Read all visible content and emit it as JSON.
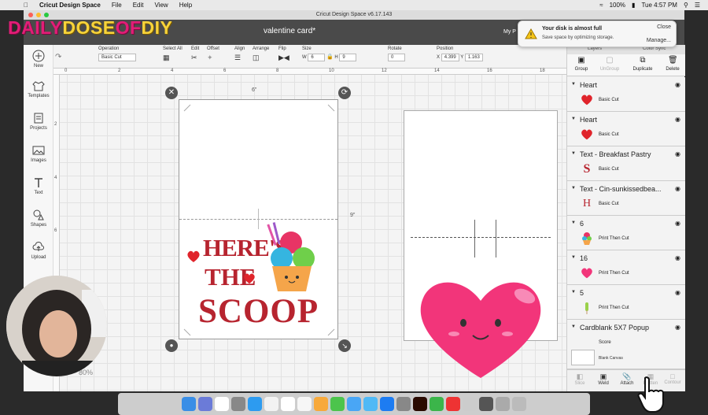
{
  "menubar": {
    "app_name": "Cricut Design Space",
    "items": [
      "File",
      "Edit",
      "View",
      "Help"
    ],
    "battery": "100%",
    "clock": "Tue 4:57 PM"
  },
  "window": {
    "title": "Cricut Design Space  v6.17.143",
    "doc_title": "valentine card*",
    "my_projects": "My P"
  },
  "brand_overlay": {
    "part1": "DAILY",
    "part2": "DOSE",
    "part3": "OF",
    "part4": "DIY"
  },
  "notification": {
    "title": "Your disk is almost full",
    "body": "Save space by optimizing storage.",
    "close": "Close",
    "manage": "Manage..."
  },
  "toolbar": {
    "operation_label": "Operation",
    "operation_value": "Basic Cut",
    "select_all": "Select All",
    "edit": "Edit",
    "offset": "Offset",
    "align": "Align",
    "arrange": "Arrange",
    "flip": "Flip",
    "size": "Size",
    "size_w_label": "W",
    "size_w": "6",
    "size_h_label": "H",
    "size_h": "9",
    "rotate": "Rotate",
    "rotate_value": "0",
    "position": "Position",
    "pos_x_label": "X",
    "pos_x": "4.399",
    "pos_y_label": "Y",
    "pos_y": "1.163"
  },
  "left_nav": [
    {
      "label": "New",
      "icon": "plus-icon"
    },
    {
      "label": "Templates",
      "icon": "shirt-icon"
    },
    {
      "label": "Projects",
      "icon": "projects-icon"
    },
    {
      "label": "Images",
      "icon": "image-icon"
    },
    {
      "label": "Text",
      "icon": "text-icon"
    },
    {
      "label": "Shapes",
      "icon": "shapes-icon"
    },
    {
      "label": "Upload",
      "icon": "upload-icon"
    }
  ],
  "rulers": {
    "top": [
      "0",
      "2",
      "4",
      "6",
      "8",
      "10",
      "12",
      "14",
      "16",
      "18"
    ],
    "left": [
      "2",
      "4",
      "6"
    ]
  },
  "canvas": {
    "width_label": "6\"",
    "height_label": "9\"",
    "card_text_line1": "HERE'S",
    "card_text_line2": "THE",
    "card_text_line3": "SCOOP",
    "zoom": "80%"
  },
  "layers_panel": {
    "tabs": [
      "Layers",
      "Color Sync"
    ],
    "actions": [
      "Group",
      "UnGroup",
      "Duplicate",
      "Delete"
    ],
    "layers": [
      {
        "name": "Heart",
        "op": "Basic Cut"
      },
      {
        "name": "Heart",
        "op": "Basic Cut"
      },
      {
        "name": "Text - Breakfast Pastry",
        "op": "Basic Cut"
      },
      {
        "name": "Text - Cin-sunkissedbea...",
        "op": "Basic Cut"
      },
      {
        "name": "6",
        "op": "Print Then Cut"
      },
      {
        "name": "16",
        "op": "Print Then Cut"
      },
      {
        "name": "5",
        "op": "Print Then Cut"
      }
    ],
    "canvas_layer": {
      "name": "Cardblank 5X7 Popup",
      "sub": "Score",
      "blank": "Blank Canvas"
    },
    "bottom": [
      "Slice",
      "Weld",
      "Attach",
      "Flatten",
      "Contour"
    ]
  },
  "colors": {
    "heart_pink": "#f2357a",
    "heart_red": "#e0242b",
    "text_red": "#b7242f",
    "header_gray": "#4a4a4a"
  }
}
